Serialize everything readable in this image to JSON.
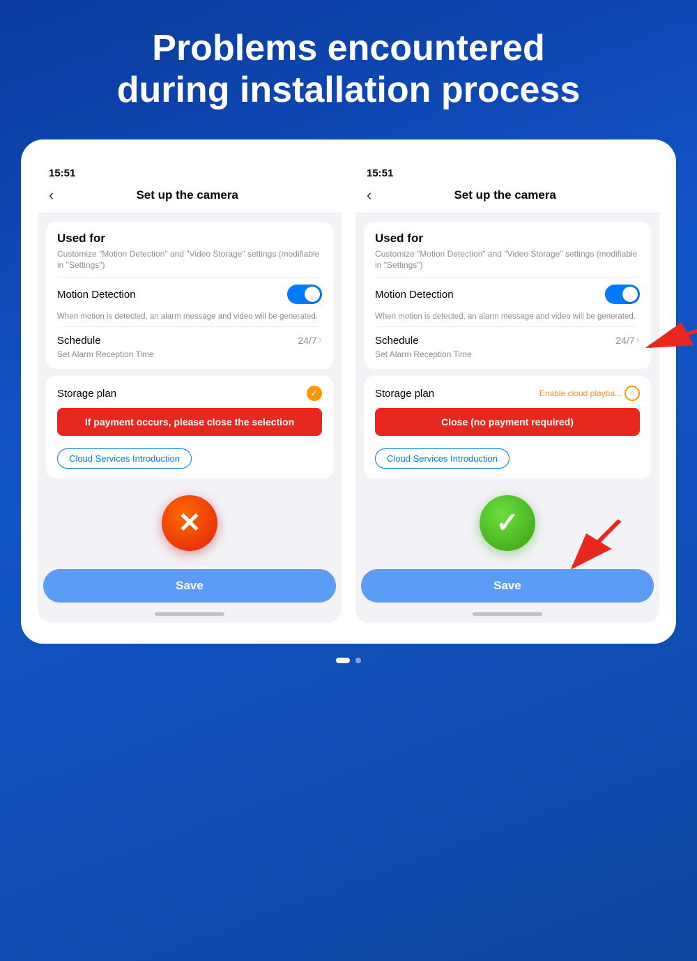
{
  "headline": {
    "line1": "Problems encountered",
    "line2": "during installation process"
  },
  "left_panel": {
    "status_time": "15:51",
    "header_back": "‹",
    "header_title": "Set up  the camera",
    "used_for_title": "Used for",
    "used_for_desc": "Customize \"Motion Detection\" and \"Video Storage\" settings (modifiable in \"Settings\")",
    "motion_detection_label": "Motion Detection",
    "motion_detection_desc": "When motion is detected, an alarm message and video will be generated.",
    "schedule_label": "Schedule",
    "schedule_value": "24/7",
    "schedule_sub": "Set Alarm Reception Time",
    "storage_label": "Storage plan",
    "alert_text": "If payment occurs, please close the selection",
    "cloud_intro_btn": "Cloud Services Introduction",
    "icon_type": "x",
    "save_label": "Save"
  },
  "right_panel": {
    "status_time": "15:51",
    "header_back": "‹",
    "header_title": "Set up  the camera",
    "used_for_title": "Used for",
    "used_for_desc": "Customize \"Motion Detection\" and \"Video Storage\" settings (modifiable in \"Settings\")",
    "motion_detection_label": "Motion Detection",
    "motion_detection_desc": "When motion is detected, an alarm message and video will be generated.",
    "schedule_label": "Schedule",
    "schedule_value": "24/7",
    "schedule_sub": "Set Alarm Reception Time",
    "storage_label": "Storage plan",
    "storage_cloud_text": "Enable cloud playba...",
    "alert_text": "Close (no payment required)",
    "cloud_intro_btn": "Cloud Services Introduction",
    "icon_type": "check",
    "save_label": "Save"
  },
  "bottom_dots": {
    "active_index": 0
  }
}
